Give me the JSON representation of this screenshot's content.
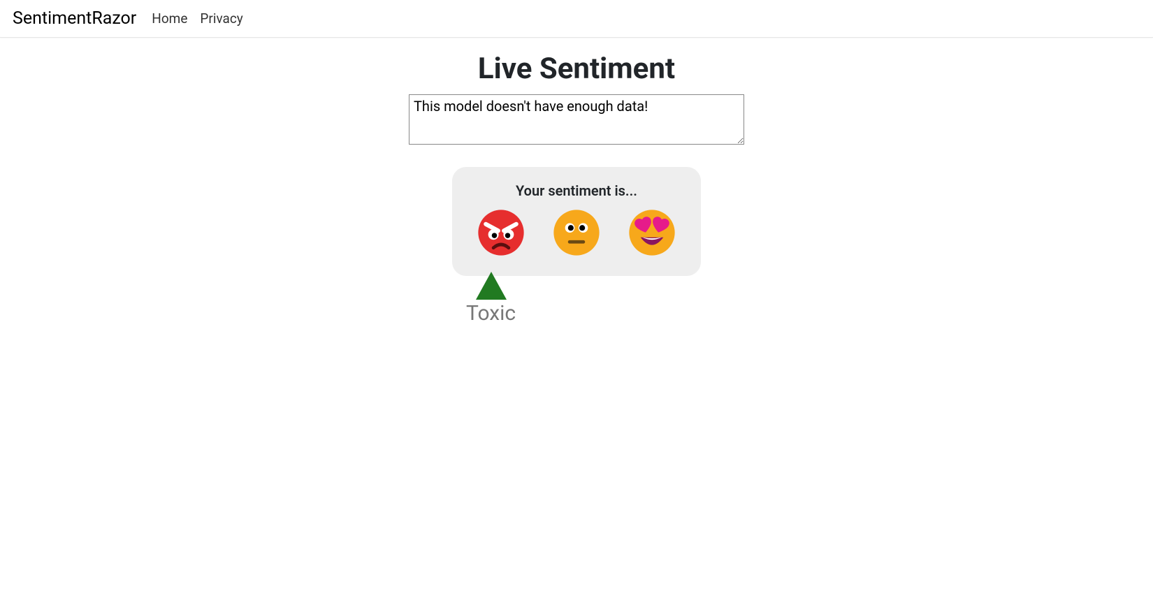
{
  "nav": {
    "brand": "SentimentRazor",
    "links": [
      "Home",
      "Privacy"
    ]
  },
  "page": {
    "title": "Live Sentiment",
    "textarea_value": "This model doesn't have enough data!"
  },
  "result": {
    "label": "Your sentiment is...",
    "marker_label": "Toxic"
  }
}
